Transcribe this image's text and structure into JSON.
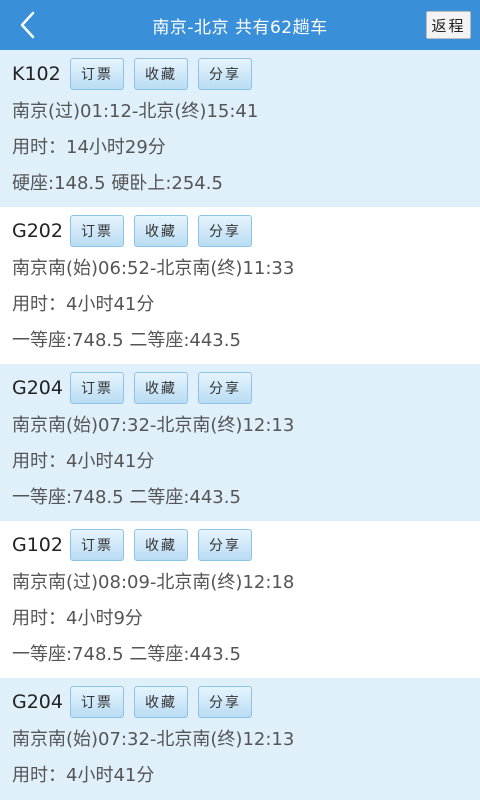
{
  "header": {
    "title": "南京-北京 共有62趟车",
    "return_label": "返程",
    "colors": {
      "bar": "#3a8fd9",
      "row_alt": "#dff0fb"
    }
  },
  "actions": {
    "book": "订票",
    "favorite": "收藏",
    "share": "分享"
  },
  "trains": [
    {
      "no": "K102",
      "route": "南京(过)01:12-北京(终)15:41",
      "duration": "用时：14小时29分",
      "price": "硬座:148.5 硬卧上:254.5"
    },
    {
      "no": "G202",
      "route": "南京南(始)06:52-北京南(终)11:33",
      "duration": "用时：4小时41分",
      "price": "一等座:748.5 二等座:443.5"
    },
    {
      "no": "G204",
      "route": "南京南(始)07:32-北京南(终)12:13",
      "duration": "用时：4小时41分",
      "price": "一等座:748.5 二等座:443.5"
    },
    {
      "no": "G102",
      "route": "南京南(过)08:09-北京南(终)12:18",
      "duration": "用时：4小时9分",
      "price": "一等座:748.5 二等座:443.5"
    },
    {
      "no": "G204",
      "route": "南京南(始)07:32-北京南(终)12:13",
      "duration": "用时：4小时41分",
      "price": ""
    }
  ]
}
